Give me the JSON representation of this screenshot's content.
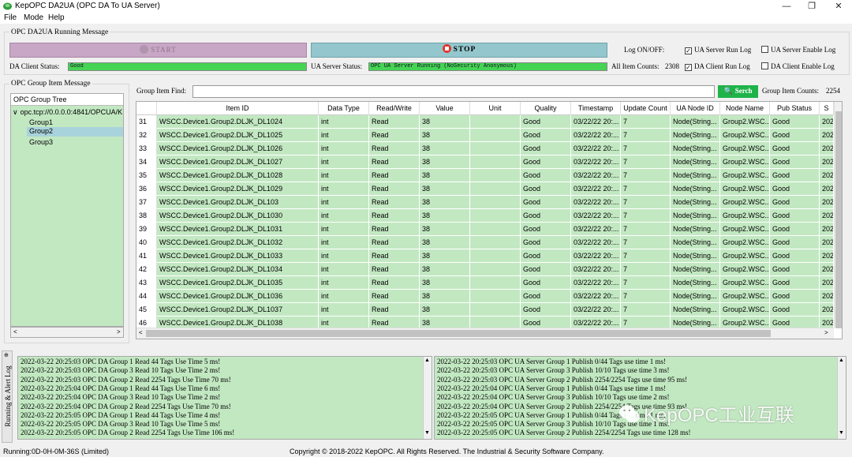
{
  "window": {
    "title": "KepOPC DA2UA (OPC DA To UA Server)",
    "minimize": "—",
    "maximize": "❐",
    "close": "✕"
  },
  "menu": [
    "File",
    "Mode",
    "Help"
  ],
  "running": {
    "group_title": "OPC DA2UA Running Message",
    "start_label": "START",
    "stop_label": "STOP",
    "log_onoff_label": "Log ON/OFF:",
    "checkboxes": [
      {
        "label": "UA Server Run Log",
        "checked": true
      },
      {
        "label": "UA Server Enable Log",
        "checked": false
      },
      {
        "label": "DA Client Run Log",
        "checked": true
      },
      {
        "label": "DA Client Enable Log",
        "checked": false
      }
    ],
    "da_client_status_label": "DA Client Status:",
    "da_client_status_value": "Good",
    "ua_server_status_label": "UA Server Status:",
    "ua_server_status_value": "OPC UA Server Running (NoSecurity Anonymous)",
    "all_item_counts_label": "All Item Counts:",
    "all_item_counts_value": "2308",
    "status_color": "#45d454"
  },
  "group_item": {
    "group_title": "OPC Group Item Message",
    "tree_title": "OPC Group Tree",
    "tree_root": "opc.tcp://0.0.0.0:4841/OPCUA/K",
    "tree_children": [
      "Group1",
      "Group2",
      "Group3"
    ],
    "selected_child": "Group2",
    "find_label": "Group Item Find:",
    "find_value": "",
    "search_label": "Serch",
    "group_item_counts_label": "Group Item Counts:",
    "group_item_counts_value": "2254"
  },
  "grid": {
    "columns": [
      "",
      "Item ID",
      "Data Type",
      "Read/Write",
      "Value",
      "Unit",
      "Quality",
      "Timestamp",
      "Update Count",
      "UA Node ID",
      "Node Name",
      "Pub Status",
      "S"
    ],
    "rows": [
      [
        "31",
        "WSCC.Device1.Group2.DLJK_DL1024",
        "int",
        "Read",
        "38",
        "",
        "Good",
        "03/22/22 20:...",
        "7",
        "Node(String...",
        "Group2.WSC...",
        "Good",
        "202"
      ],
      [
        "32",
        "WSCC.Device1.Group2.DLJK_DL1025",
        "int",
        "Read",
        "38",
        "",
        "Good",
        "03/22/22 20:...",
        "7",
        "Node(String...",
        "Group2.WSC...",
        "Good",
        "202"
      ],
      [
        "33",
        "WSCC.Device1.Group2.DLJK_DL1026",
        "int",
        "Read",
        "38",
        "",
        "Good",
        "03/22/22 20:...",
        "7",
        "Node(String...",
        "Group2.WSC...",
        "Good",
        "202"
      ],
      [
        "34",
        "WSCC.Device1.Group2.DLJK_DL1027",
        "int",
        "Read",
        "38",
        "",
        "Good",
        "03/22/22 20:...",
        "7",
        "Node(String...",
        "Group2.WSC...",
        "Good",
        "202"
      ],
      [
        "35",
        "WSCC.Device1.Group2.DLJK_DL1028",
        "int",
        "Read",
        "38",
        "",
        "Good",
        "03/22/22 20:...",
        "7",
        "Node(String...",
        "Group2.WSC...",
        "Good",
        "202"
      ],
      [
        "36",
        "WSCC.Device1.Group2.DLJK_DL1029",
        "int",
        "Read",
        "38",
        "",
        "Good",
        "03/22/22 20:...",
        "7",
        "Node(String...",
        "Group2.WSC...",
        "Good",
        "202"
      ],
      [
        "37",
        "WSCC.Device1.Group2.DLJK_DL103",
        "int",
        "Read",
        "38",
        "",
        "Good",
        "03/22/22 20:...",
        "7",
        "Node(String...",
        "Group2.WSC...",
        "Good",
        "202"
      ],
      [
        "38",
        "WSCC.Device1.Group2.DLJK_DL1030",
        "int",
        "Read",
        "38",
        "",
        "Good",
        "03/22/22 20:...",
        "7",
        "Node(String...",
        "Group2.WSC...",
        "Good",
        "202"
      ],
      [
        "39",
        "WSCC.Device1.Group2.DLJK_DL1031",
        "int",
        "Read",
        "38",
        "",
        "Good",
        "03/22/22 20:...",
        "7",
        "Node(String...",
        "Group2.WSC...",
        "Good",
        "202"
      ],
      [
        "40",
        "WSCC.Device1.Group2.DLJK_DL1032",
        "int",
        "Read",
        "38",
        "",
        "Good",
        "03/22/22 20:...",
        "7",
        "Node(String...",
        "Group2.WSC...",
        "Good",
        "202"
      ],
      [
        "41",
        "WSCC.Device1.Group2.DLJK_DL1033",
        "int",
        "Read",
        "38",
        "",
        "Good",
        "03/22/22 20:...",
        "7",
        "Node(String...",
        "Group2.WSC...",
        "Good",
        "202"
      ],
      [
        "42",
        "WSCC.Device1.Group2.DLJK_DL1034",
        "int",
        "Read",
        "38",
        "",
        "Good",
        "03/22/22 20:...",
        "7",
        "Node(String...",
        "Group2.WSC...",
        "Good",
        "202"
      ],
      [
        "43",
        "WSCC.Device1.Group2.DLJK_DL1035",
        "int",
        "Read",
        "38",
        "",
        "Good",
        "03/22/22 20:...",
        "7",
        "Node(String...",
        "Group2.WSC...",
        "Good",
        "202"
      ],
      [
        "44",
        "WSCC.Device1.Group2.DLJK_DL1036",
        "int",
        "Read",
        "38",
        "",
        "Good",
        "03/22/22 20:...",
        "7",
        "Node(String...",
        "Group2.WSC...",
        "Good",
        "202"
      ],
      [
        "45",
        "WSCC.Device1.Group2.DLJK_DL1037",
        "int",
        "Read",
        "38",
        "",
        "Good",
        "03/22/22 20:...",
        "7",
        "Node(String...",
        "Group2.WSC...",
        "Good",
        "202"
      ],
      [
        "46",
        "WSCC.Device1.Group2.DLJK_DL1038",
        "int",
        "Read",
        "38",
        "",
        "Good",
        "03/22/22 20:...",
        "7",
        "Node(String...",
        "Group2.WSC...",
        "Good",
        "202"
      ]
    ]
  },
  "logs": {
    "side_tab": "Running & Alert Log",
    "da_log": [
      "2022-03-22 20:25:03  OPC DA Group 1 Read 44 Tags Use Time 5 ms!",
      "2022-03-22 20:25:03  OPC DA Group 3 Read 10 Tags Use Time 2 ms!",
      "2022-03-22 20:25:03  OPC DA Group 2 Read 2254 Tags Use Time 70 ms!",
      "2022-03-22 20:25:04  OPC DA Group 1 Read 44 Tags Use Time 6 ms!",
      "2022-03-22 20:25:04  OPC DA Group 3 Read 10 Tags Use Time 2 ms!",
      "2022-03-22 20:25:04  OPC DA Group 2 Read 2254 Tags Use Time 70 ms!",
      "2022-03-22 20:25:05  OPC DA Group 1 Read 44 Tags Use Time 4 ms!",
      "2022-03-22 20:25:05  OPC DA Group 3 Read 10 Tags Use Time 5 ms!",
      "2022-03-22 20:25:05  OPC DA Group 2 Read 2254 Tags Use Time 106 ms!"
    ],
    "ua_log": [
      "2022-03-22 20:25:03  OPC UA Server Group 1 Publish 0/44 Tags use time 1 ms!",
      "2022-03-22 20:25:03  OPC UA Server Group 3 Publish 10/10 Tags use time 3 ms!",
      "2022-03-22 20:25:03  OPC UA Server Group 2 Publish 2254/2254 Tags use time 95 ms!",
      "2022-03-22 20:25:04  OPC UA Server Group 1 Publish 0/44 Tags use time 1 ms!",
      "2022-03-22 20:25:04  OPC UA Server Group 3 Publish 10/10 Tags use time 2 ms!",
      "2022-03-22 20:25:04  OPC UA Server Group 2 Publish 2254/2254 Tags use time 93 ms!",
      "2022-03-22 20:25:05  OPC UA Server Group 1 Publish 0/44 Tags use time 1 ms!",
      "2022-03-22 20:25:05  OPC UA Server Group 3 Publish 10/10 Tags use time 1 ms!",
      "2022-03-22 20:25:05  OPC UA Server Group 2 Publish 2254/2254 Tags use time 128 ms!"
    ]
  },
  "footer": {
    "running_time": "Running:0D-0H-0M-36S  (Limited)",
    "copyright": "Copyright © 2018-2022 KepOPC. All Rights Reserved. The Industrial & Security Software Company."
  },
  "watermark": "KepOPC工业互联",
  "icons": {
    "arrow_down": "▼",
    "arrow_up": "▲",
    "arrow_left": "<",
    "arrow_right": ">",
    "expand": "∨",
    "pin": "📌"
  }
}
